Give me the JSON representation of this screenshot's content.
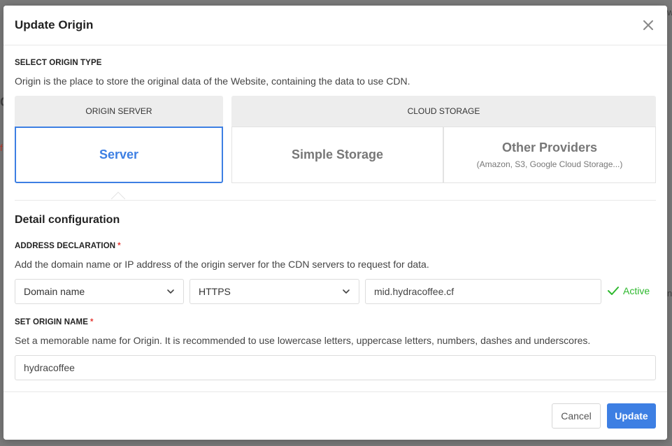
{
  "background": {
    "fragment_right_1": "w",
    "fragment_left_1": "C",
    "fragment_left_2": "f",
    "fragment_right_2": "n"
  },
  "modal": {
    "title": "Update Origin",
    "close_icon": "close-icon"
  },
  "origin_type": {
    "label": "SELECT ORIGIN TYPE",
    "description": "Origin is the place to store the original data of the Website, containing the data to use CDN.",
    "groups": [
      {
        "label": "ORIGIN SERVER"
      },
      {
        "label": "CLOUD STORAGE"
      }
    ],
    "options": [
      {
        "title": "Server",
        "subtitle": "",
        "selected": true
      },
      {
        "title": "Simple Storage",
        "subtitle": "",
        "selected": false
      },
      {
        "title": "Other Providers",
        "subtitle": "(Amazon, S3, Google Cloud Storage...)",
        "selected": false
      }
    ]
  },
  "detail": {
    "title": "Detail configuration"
  },
  "address": {
    "label": "ADDRESS DECLARATION",
    "required_mark": "*",
    "description": "Add the domain name or IP address of the origin server for the CDN servers to request for data.",
    "type_select": "Domain name",
    "protocol_select": "HTTPS",
    "value": "mid.hydracoffee.cf",
    "status": "Active"
  },
  "origin_name": {
    "label": "SET ORIGIN NAME",
    "required_mark": "*",
    "description": "Set a memorable name for Origin. It is recommended to use lowercase letters, uppercase letters, numbers, dashes and underscores.",
    "value": "hydracoffee"
  },
  "footer": {
    "cancel_label": "Cancel",
    "update_label": "Update"
  },
  "colors": {
    "accent": "#3d7fe3",
    "success": "#2eb82e",
    "required": "#e53935"
  }
}
